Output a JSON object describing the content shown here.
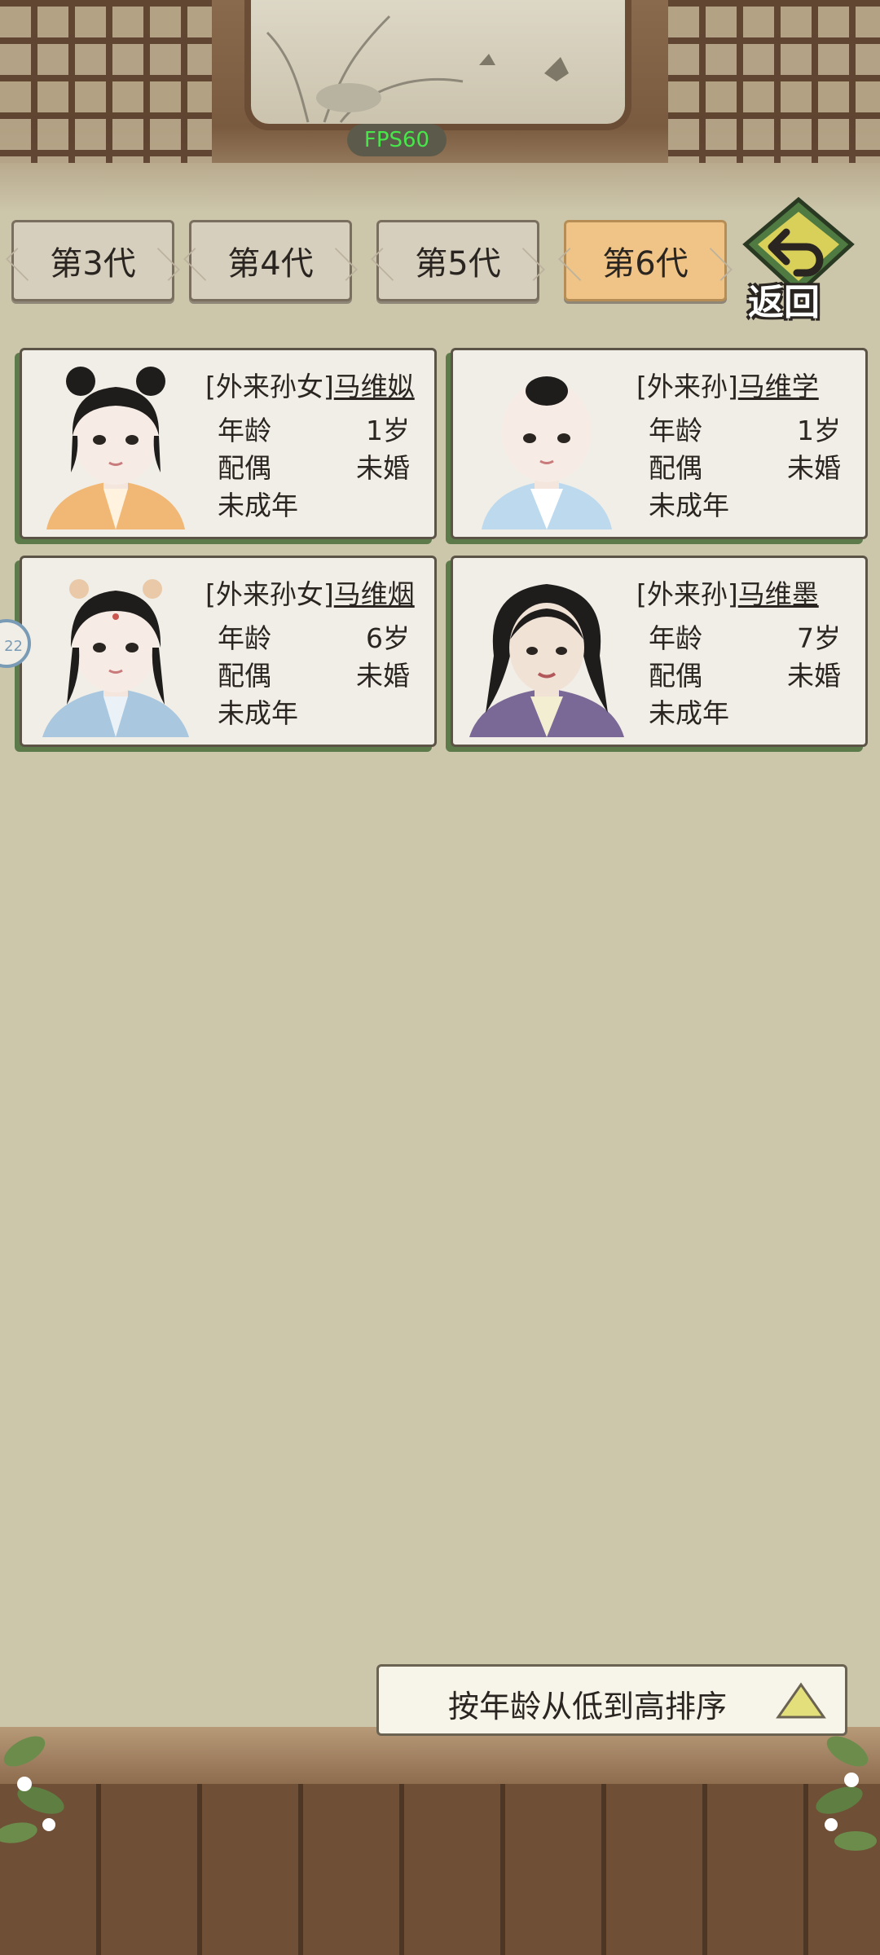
{
  "fps_label": "FPS60",
  "generation_tabs": [
    {
      "label": "第3代",
      "active": false
    },
    {
      "label": "第4代",
      "active": false
    },
    {
      "label": "第5代",
      "active": false
    },
    {
      "label": "第6代",
      "active": true
    }
  ],
  "back_button": {
    "label": "返回",
    "icon": "back-arrow-icon"
  },
  "field_labels": {
    "age": "年龄",
    "spouse": "配偶"
  },
  "members": [
    {
      "title": "[外来孙女]",
      "name": "马维姒",
      "age": "1岁",
      "spouse": "未婚",
      "status": "未成年",
      "outfit_color": "#f1b775"
    },
    {
      "title": "[外来孙]",
      "name": "马维学",
      "age": "1岁",
      "spouse": "未婚",
      "status": "未成年",
      "outfit_color": "#bcd9ee"
    },
    {
      "title": "[外来孙女]",
      "name": "马维烟",
      "age": "6岁",
      "spouse": "未婚",
      "status": "未成年",
      "outfit_color": "#a9c7df"
    },
    {
      "title": "[外来孙]",
      "name": "马维墨",
      "age": "7岁",
      "spouse": "未婚",
      "status": "未成年",
      "outfit_color": "#7a6896"
    }
  ],
  "side_marker_label": "22",
  "sort_button": {
    "label": "按年龄从低到高排序",
    "icon": "triangle-up-icon"
  },
  "colors": {
    "active_tab": "#efc486",
    "card_shadow": "#5d7a4a",
    "fps_text": "#48e64a"
  }
}
